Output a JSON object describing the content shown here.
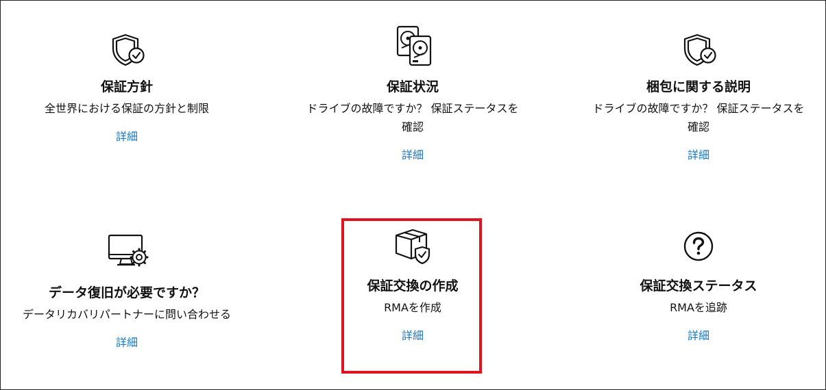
{
  "cards": [
    {
      "icon": "shield-check-icon",
      "title": "保証方針",
      "description": "全世界における保証の方針と制限",
      "link": "詳細"
    },
    {
      "icon": "hard-drives-icon",
      "title": "保証状況",
      "description": "ドライブの故障ですか？ 保証ステータスを確認",
      "link": "詳細"
    },
    {
      "icon": "shield-check-icon",
      "title": "梱包に関する説明",
      "description": "ドライブの故障ですか？ 保証ステータスを確認",
      "link": "詳細"
    },
    {
      "icon": "monitor-gear-icon",
      "title": "データ復旧が必要ですか？",
      "description": "データリカバリパートナーに問い合わせる",
      "link": "詳細"
    },
    {
      "icon": "box-shield-icon",
      "title": "保証交換の作成",
      "description": "RMAを作成",
      "link": "詳細"
    },
    {
      "icon": "question-icon",
      "title": "保証交換ステータス",
      "description": "RMAを追跡",
      "link": "詳細"
    }
  ],
  "colors": {
    "link": "#1c78c0",
    "highlight": "#e0141e",
    "text": "#111111"
  }
}
